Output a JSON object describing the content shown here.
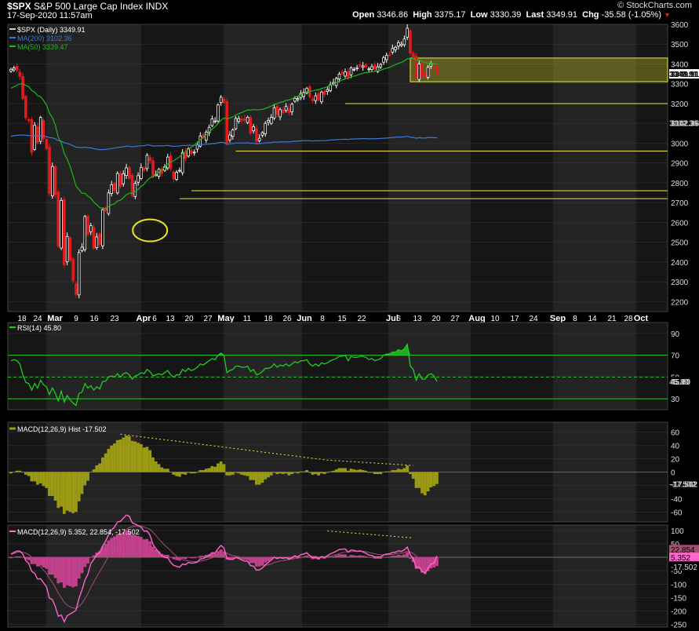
{
  "header": {
    "symbol": "$SPX",
    "name": "S&P 500 Large Cap Index",
    "exchange": "INDX",
    "datetime": "17-Sep-2020 11:57am",
    "credit": "© StockCharts.com",
    "open_label": "Open",
    "open": "3346.86",
    "high_label": "High",
    "high": "3375.17",
    "low_label": "Low",
    "low": "3330.39",
    "last_label": "Last",
    "last": "3349.91",
    "chg_label": "Chg",
    "chg": "-35.58 (-1.05%)",
    "chg_arrow": "▼"
  },
  "colors": {
    "background": "#000000",
    "panel": "#161616",
    "band": "#242424",
    "up": "#ffffff",
    "down": "#e21b1b",
    "ma200": "#3b78d8",
    "ma50": "#1bb81b",
    "support": "#e8e84a",
    "rsi": "#22cc22",
    "macd_hist": "#9a9a14",
    "macd_line": "#ff66cc"
  },
  "chart_data": [
    {
      "id": "price",
      "type": "candlestick",
      "legend": [
        "$SPX (Daily) 3349.91",
        "MA(200) 3102.36",
        "MA(50) 3339.47"
      ],
      "ylim": [
        2150,
        3600
      ],
      "yticks": [
        2200,
        2300,
        2400,
        2500,
        2600,
        2700,
        2800,
        2900,
        3000,
        3100,
        3200,
        3300,
        3400,
        3500,
        3600
      ],
      "x_labels": [
        "18",
        "24",
        "Mar",
        "9",
        "16",
        "23",
        "Apr",
        "6",
        "13",
        "20",
        "27",
        "May",
        "11",
        "18",
        "26",
        "Jun",
        "8",
        "15",
        "22",
        "Jul",
        "6",
        "13",
        "20",
        "27",
        "Aug",
        "10",
        "17",
        "24",
        "Sep",
        "8",
        "14",
        "21",
        "28",
        "Oct"
      ],
      "bold_x_labels": [
        "Mar",
        "Apr",
        "May",
        "Jun",
        "Jul",
        "Aug",
        "Sep",
        "Oct"
      ],
      "closes": [
        3373,
        3380,
        3370,
        3337,
        3225,
        3128,
        3116,
        2954,
        3090,
        3003,
        3130,
        3023,
        2972,
        2746,
        2882,
        2741,
        2480,
        2711,
        2386,
        2529,
        2409,
        2305,
        2237,
        2448,
        2475,
        2630,
        2541,
        2584,
        2470,
        2527,
        2488,
        2664,
        2660,
        2749,
        2790,
        2761,
        2847,
        2783,
        2846,
        2875,
        2823,
        2737,
        2797,
        2836,
        2878,
        2863,
        2939,
        2912,
        2830,
        2842,
        2868,
        2848,
        2881,
        2930,
        2870,
        2820,
        2853,
        2863,
        2953,
        2923,
        2972,
        2948,
        2955,
        2991,
        3036,
        3030,
        3056,
        3080,
        3123,
        3112,
        3193,
        3232,
        3207,
        3002,
        3041,
        3067,
        3125,
        3124,
        3113,
        3116,
        3131,
        3050,
        3083,
        3009,
        3025,
        3053,
        3100,
        3115,
        3130,
        3179,
        3145,
        3169,
        3153,
        3185,
        3155,
        3197,
        3226,
        3225,
        3251,
        3257,
        3276,
        3235,
        3215,
        3239,
        3218,
        3258,
        3246,
        3271,
        3295,
        3306,
        3327,
        3349,
        3351,
        3360,
        3333,
        3380,
        3373,
        3381,
        3389,
        3390,
        3386,
        3375,
        3386,
        3374,
        3385,
        3397,
        3431,
        3443,
        3444,
        3478,
        3484,
        3508,
        3500,
        3526,
        3580,
        3455,
        3427,
        3331,
        3399,
        3340,
        3339,
        3383,
        3401,
        3385,
        3350
      ],
      "ma200": [
        3035,
        3038,
        3040,
        3041,
        3041,
        3040,
        3039,
        3036,
        3037,
        3036,
        3037,
        3036,
        3034,
        3028,
        3027,
        3022,
        3013,
        3011,
        3002,
        2999,
        2994,
        2987,
        2980,
        2979,
        2978,
        2980,
        2977,
        2977,
        2972,
        2970,
        2967,
        2968,
        2968,
        2971,
        2974,
        2975,
        2979,
        2979,
        2982,
        2985,
        2985,
        2981,
        2983,
        2985,
        2987,
        2987,
        2991,
        2990,
        2986,
        2986,
        2987,
        2986,
        2987,
        2989,
        2986,
        2984,
        2985,
        2985,
        2989,
        2988,
        2990,
        2989,
        2990,
        2991,
        2993,
        2993,
        2995,
        2996,
        2998,
        2998,
        3002,
        3004,
        3003,
        2995,
        2997,
        2998,
        3001,
        3001,
        3001,
        3001,
        3002,
        2999,
        3000,
        2997,
        2998,
        2999,
        3001,
        3002,
        3003,
        3006,
        3005,
        3006,
        3006,
        3007,
        3006,
        3008,
        3010,
        3010,
        3012,
        3012,
        3013,
        3012,
        3011,
        3012,
        3012,
        3013,
        3013,
        3014,
        3016,
        3016,
        3018,
        3019,
        3019,
        3020,
        3019,
        3021,
        3021,
        3022,
        3022,
        3023,
        3023,
        3022,
        3023,
        3022,
        3023,
        3024,
        3025,
        3026,
        3027,
        3029,
        3030,
        3031,
        3031,
        3032,
        3035,
        3030,
        3029,
        3025,
        3028,
        3026,
        3026,
        3028,
        3029,
        3028,
        3027
      ],
      "ma50": [
        3277,
        3285,
        3293,
        3299,
        3298,
        3292,
        3286,
        3266,
        3258,
        3240,
        3235,
        3216,
        3193,
        3152,
        3129,
        3092,
        3029,
        3002,
        2947,
        2920,
        2882,
        2834,
        2784,
        2765,
        2747,
        2747,
        2732,
        2723,
        2702,
        2690,
        2674,
        2673,
        2671,
        2679,
        2689,
        2694,
        2708,
        2712,
        2725,
        2740,
        2748,
        2747,
        2756,
        2767,
        2782,
        2793,
        2812,
        2826,
        2831,
        2841,
        2853,
        2863,
        2878,
        2895,
        2905,
        2911,
        2921,
        2931,
        2947,
        2957,
        2970,
        2980,
        2990,
        3003,
        3018,
        3030,
        3043,
        3057,
        3072,
        3083,
        3100,
        3116,
        3127,
        3123,
        3127,
        3133,
        3142,
        3149,
        3155,
        3161,
        3168,
        3167,
        3170,
        3168,
        3169,
        3171,
        3176,
        3181,
        3187,
        3196,
        3200,
        3206,
        3209,
        3216,
        3218,
        3224,
        3231,
        3237,
        3245,
        3252,
        3259,
        3262,
        3264,
        3268,
        3270,
        3276,
        3280,
        3286,
        3293,
        3299,
        3306,
        3313,
        3319,
        3325,
        3328,
        3334,
        3338,
        3343,
        3349,
        3353,
        3356,
        3358,
        3361,
        3363,
        3365,
        3368,
        3374,
        3379,
        3383,
        3390,
        3396,
        3403,
        3408,
        3415,
        3426,
        3427,
        3427,
        3421,
        3419,
        3413,
        3407,
        3405,
        3404,
        3402,
        3398
      ],
      "support_levels": [
        3200,
        2960,
        2760,
        2720
      ],
      "last_value": "3349.91",
      "ma200_value": "3102.36"
    },
    {
      "id": "rsi",
      "type": "line",
      "legend": "RSI(14) 45.80",
      "ylim": [
        20,
        100
      ],
      "yticks": [
        30,
        50,
        70,
        90
      ],
      "levels": [
        30,
        50,
        70
      ],
      "values": [
        65,
        66,
        65,
        62,
        52,
        45,
        44,
        38,
        44,
        40,
        47,
        43,
        41,
        34,
        40,
        35,
        28,
        37,
        27,
        33,
        29,
        26,
        24,
        35,
        36,
        44,
        40,
        42,
        38,
        41,
        39,
        46,
        46,
        50,
        51,
        50,
        53,
        50,
        53,
        54,
        52,
        48,
        51,
        52,
        54,
        53,
        57,
        55,
        51,
        52,
        53,
        52,
        54,
        56,
        52,
        50,
        52,
        52,
        57,
        55,
        58,
        56,
        57,
        59,
        62,
        61,
        63,
        65,
        67,
        66,
        70,
        72,
        70,
        54,
        56,
        57,
        60,
        60,
        59,
        59,
        60,
        55,
        57,
        52,
        53,
        55,
        58,
        58,
        59,
        62,
        59,
        61,
        60,
        62,
        60,
        62,
        64,
        63,
        65,
        65,
        66,
        62,
        60,
        62,
        60,
        63,
        62,
        63,
        65,
        66,
        67,
        69,
        69,
        70,
        65,
        69,
        68,
        68,
        69,
        69,
        68,
        66,
        67,
        65,
        66,
        67,
        70,
        71,
        71,
        73,
        73,
        75,
        74,
        76,
        80,
        60,
        57,
        47,
        53,
        48,
        48,
        52,
        53,
        51,
        46
      ],
      "last_value": "45.80"
    },
    {
      "id": "macd_hist",
      "type": "bar",
      "legend": "MACD(12,26,9) Hist -17.502",
      "ylim": [
        -75,
        75
      ],
      "yticks": [
        -60,
        -40,
        -20,
        0,
        20,
        40,
        60
      ],
      "values": [
        -2,
        0,
        2,
        2,
        0,
        -4,
        -6,
        -14,
        -14,
        -19,
        -17,
        -21,
        -24,
        -36,
        -36,
        -43,
        -54,
        -52,
        -63,
        -58,
        -60,
        -62,
        -60,
        -44,
        -33,
        -20,
        -13,
        0,
        4,
        10,
        13,
        22,
        28,
        35,
        40,
        43,
        48,
        49,
        52,
        55,
        54,
        47,
        46,
        44,
        42,
        37,
        38,
        33,
        22,
        16,
        12,
        7,
        5,
        5,
        0,
        -4,
        -6,
        -7,
        -3,
        -4,
        -1,
        -2,
        -2,
        -1,
        3,
        3,
        5,
        6,
        9,
        8,
        13,
        16,
        12,
        -5,
        -5,
        -4,
        -1,
        -2,
        -4,
        -5,
        -6,
        -12,
        -12,
        -19,
        -19,
        -16,
        -11,
        -8,
        -5,
        -1,
        -3,
        -2,
        -3,
        -2,
        -5,
        -3,
        -1,
        -2,
        1,
        1,
        3,
        -1,
        -4,
        -3,
        -5,
        -2,
        -3,
        -1,
        1,
        2,
        4,
        6,
        6,
        6,
        2,
        5,
        4,
        3,
        4,
        3,
        2,
        -1,
        -1,
        -3,
        -3,
        -3,
        0,
        1,
        1,
        3,
        3,
        5,
        4,
        6,
        10,
        -3,
        -10,
        -24,
        -24,
        -32,
        -35,
        -29,
        -23,
        -21,
        -18
      ],
      "last_value": "-17.502"
    },
    {
      "id": "macd",
      "type": "line",
      "legend": "MACD(12,26,9) 5.352, 22.854, -17.502",
      "ylim": [
        -260,
        120
      ],
      "yticks": [
        -250,
        -200,
        -150,
        -100,
        -50,
        0,
        50,
        100
      ],
      "macd": [
        12,
        18,
        23,
        23,
        12,
        -12,
        -23,
        -52,
        -60,
        -81,
        -80,
        -95,
        -110,
        -152,
        -158,
        -183,
        -220,
        -215,
        -240,
        -218,
        -211,
        -205,
        -197,
        -153,
        -122,
        -85,
        -63,
        -23,
        -8,
        9,
        18,
        42,
        60,
        84,
        102,
        112,
        131,
        134,
        146,
        157,
        153,
        128,
        124,
        118,
        112,
        97,
        98,
        82,
        48,
        32,
        19,
        6,
        -1,
        -2,
        -19,
        -30,
        -34,
        -37,
        -25,
        -28,
        -19,
        -22,
        -21,
        -18,
        -6,
        -5,
        1,
        7,
        17,
        16,
        32,
        44,
        35,
        -3,
        -8,
        -8,
        -1,
        -4,
        -10,
        -14,
        -15,
        -31,
        -33,
        -48,
        -47,
        -40,
        -28,
        -19,
        -10,
        0,
        -5,
        -1,
        -4,
        -1,
        -7,
        -1,
        5,
        1,
        10,
        12,
        17,
        6,
        -2,
        1,
        -5,
        3,
        0,
        6,
        13,
        17,
        23,
        29,
        30,
        31,
        19,
        27,
        26,
        22,
        24,
        20,
        15,
        8,
        7,
        1,
        2,
        1,
        9,
        12,
        13,
        18,
        19,
        24,
        22,
        28,
        38,
        9,
        -4,
        -38,
        -36,
        -53,
        -58,
        -41,
        -26,
        -22,
        5
      ],
      "signal": [
        10,
        14,
        18,
        20,
        19,
        15,
        10,
        1,
        -11,
        -25,
        -36,
        -48,
        -60,
        -78,
        -94,
        -112,
        -134,
        -150,
        -168,
        -178,
        -185,
        -189,
        -191,
        -183,
        -171,
        -154,
        -136,
        -113,
        -92,
        -72,
        -54,
        -35,
        -16,
        4,
        23,
        41,
        59,
        74,
        88,
        101,
        111,
        114,
        116,
        117,
        116,
        112,
        109,
        104,
        93,
        81,
        68,
        56,
        44,
        35,
        24,
        13,
        3,
        -5,
        -9,
        -12,
        -14,
        -15,
        -16,
        -16,
        -14,
        -12,
        -9,
        -6,
        -2,
        2,
        8,
        15,
        19,
        15,
        10,
        6,
        4,
        2,
        -1,
        -4,
        -6,
        -11,
        -16,
        -22,
        -27,
        -30,
        -30,
        -28,
        -25,
        -20,
        -17,
        -14,
        -12,
        -10,
        -9,
        -7,
        -5,
        -4,
        -1,
        2,
        5,
        5,
        4,
        3,
        1,
        1,
        1,
        2,
        4,
        7,
        10,
        14,
        17,
        20,
        20,
        21,
        22,
        22,
        22,
        22,
        21,
        18,
        16,
        13,
        11,
        9,
        9,
        9,
        10,
        11,
        13,
        15,
        16,
        18,
        22,
        19,
        15,
        4,
        -4,
        -14,
        -22,
        -26,
        -26,
        -25,
        -19
      ],
      "hist": [
        -2,
        0,
        2,
        2,
        0,
        -4,
        -6,
        -14,
        -14,
        -19,
        -17,
        -21,
        -24,
        -36,
        -36,
        -43,
        -54,
        -52,
        -63,
        -58,
        -60,
        -62,
        -60,
        -44,
        -33,
        -20,
        -13,
        0,
        4,
        10,
        13,
        22,
        28,
        35,
        40,
        43,
        48,
        49,
        52,
        55,
        54,
        47,
        46,
        44,
        42,
        37,
        38,
        33,
        22,
        16,
        12,
        7,
        5,
        5,
        0,
        -4,
        -6,
        -7,
        -3,
        -4,
        -1,
        -2,
        -2,
        -1,
        3,
        3,
        5,
        6,
        9,
        8,
        13,
        16,
        12,
        -5,
        -5,
        -4,
        -1,
        -2,
        -4,
        -5,
        -6,
        -12,
        -12,
        -19,
        -19,
        -16,
        -11,
        -8,
        -5,
        -1,
        -3,
        -2,
        -3,
        -2,
        -5,
        -3,
        -1,
        -2,
        1,
        1,
        3,
        -1,
        -4,
        -3,
        -5,
        -2,
        -3,
        -1,
        1,
        2,
        4,
        6,
        6,
        6,
        2,
        5,
        4,
        3,
        4,
        3,
        2,
        -1,
        -1,
        -3,
        -3,
        -3,
        0,
        1,
        1,
        3,
        3,
        5,
        4,
        6,
        10,
        -3,
        -10,
        -24,
        -24,
        -32,
        -35,
        -29,
        -23,
        -21,
        -18
      ],
      "tags": [
        "22.854",
        "5.352",
        "-17.502"
      ]
    }
  ]
}
